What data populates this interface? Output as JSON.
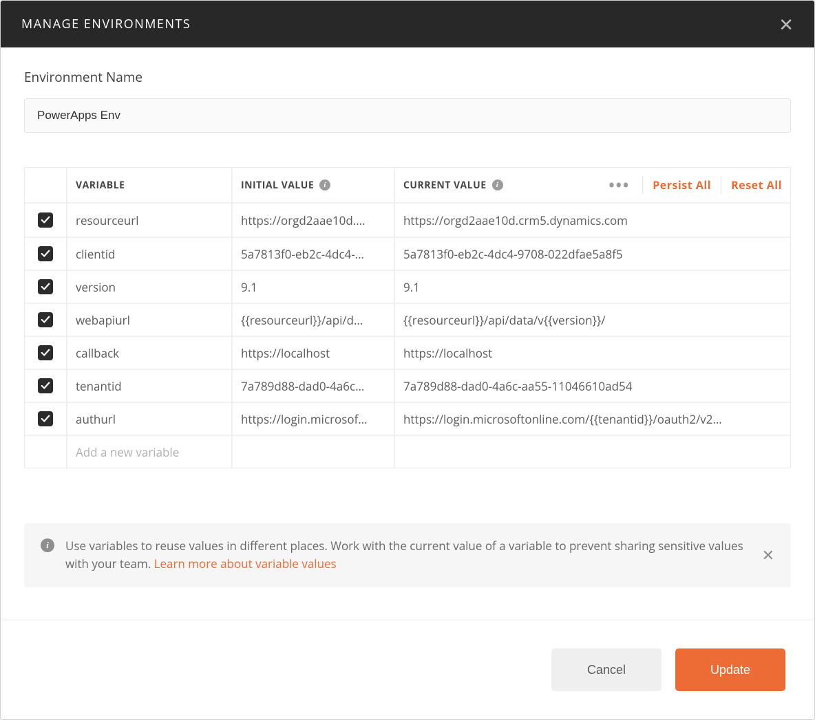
{
  "header": {
    "title": "MANAGE ENVIRONMENTS"
  },
  "form": {
    "nameLabel": "Environment Name",
    "nameValue": "PowerApps Env"
  },
  "table": {
    "headers": {
      "variable": "VARIABLE",
      "initial": "INITIAL VALUE",
      "current": "CURRENT VALUE"
    },
    "actions": {
      "persist": "Persist All",
      "reset": "Reset All"
    },
    "newPlaceholder": "Add a new variable",
    "rows": [
      {
        "checked": true,
        "variable": "resourceurl",
        "initial": "https://orgd2aae10d.…",
        "current": "https://orgd2aae10d.crm5.dynamics.com"
      },
      {
        "checked": true,
        "variable": "clientid",
        "initial": "5a7813f0-eb2c-4dc4-…",
        "current": "5a7813f0-eb2c-4dc4-9708-022dfae5a8f5"
      },
      {
        "checked": true,
        "variable": "version",
        "initial": "9.1",
        "current": "9.1"
      },
      {
        "checked": true,
        "variable": "webapiurl",
        "initial": "{{resourceurl}}/api/d…",
        "current": "{{resourceurl}}/api/data/v{{version}}/"
      },
      {
        "checked": true,
        "variable": "callback",
        "initial": "https://localhost",
        "current": "https://localhost"
      },
      {
        "checked": true,
        "variable": "tenantid",
        "initial": "7a789d88-dad0-4a6c…",
        "current": "7a789d88-dad0-4a6c-aa55-11046610ad54"
      },
      {
        "checked": true,
        "variable": "authurl",
        "initial": "https://login.microsof…",
        "current": "https://login.microsoftonline.com/{{tenantid}}/oauth2/v2…"
      }
    ]
  },
  "banner": {
    "text": "Use variables to reuse values in different places. Work with the current value of a variable to prevent sharing sensitive values with your team. ",
    "link": "Learn more about variable values"
  },
  "footer": {
    "cancel": "Cancel",
    "update": "Update"
  }
}
